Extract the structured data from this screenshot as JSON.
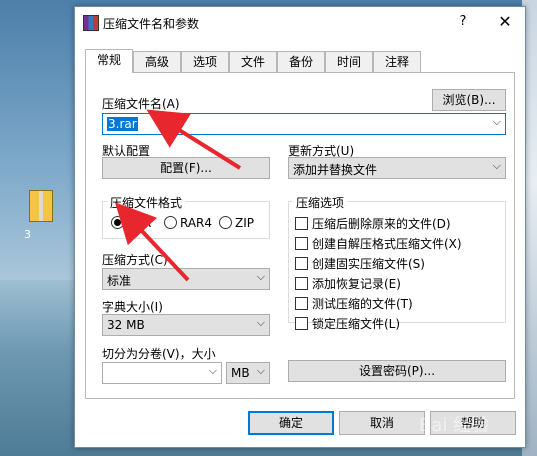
{
  "desktop": {
    "icon_label": "3"
  },
  "dialog": {
    "title": "压缩文件名和参数",
    "help": "?",
    "close": "✕"
  },
  "tabs": [
    {
      "label": "常规"
    },
    {
      "label": "高级"
    },
    {
      "label": "选项"
    },
    {
      "label": "文件"
    },
    {
      "label": "备份"
    },
    {
      "label": "时间"
    },
    {
      "label": "注释"
    }
  ],
  "general": {
    "archive_name_label": "压缩文件名(A)",
    "browse_label": "浏览(B)...",
    "archive_name_value": "3.rar",
    "default_profile_label": "默认配置",
    "profile_button": "配置(F)...",
    "update_mode_label": "更新方式(U)",
    "update_mode_value": "添加并替换文件",
    "format_group_title": "压缩文件格式",
    "formats": [
      {
        "label": "RAR",
        "selected": true
      },
      {
        "label": "RAR4",
        "selected": false
      },
      {
        "label": "ZIP",
        "selected": false
      }
    ],
    "options_group_title": "压缩选项",
    "options": [
      {
        "label": "压缩后删除原来的文件(D)",
        "checked": false
      },
      {
        "label": "创建自解压格式压缩文件(X)",
        "checked": false
      },
      {
        "label": "创建固实压缩文件(S)",
        "checked": false
      },
      {
        "label": "添加恢复记录(E)",
        "checked": false
      },
      {
        "label": "测试压缩的文件(T)",
        "checked": false
      },
      {
        "label": "锁定压缩文件(L)",
        "checked": false
      }
    ],
    "method_label": "压缩方式(C)",
    "method_value": "标准",
    "dict_label": "字典大小(I)",
    "dict_value": "32 MB",
    "split_label": "切分为分卷(V)，大小",
    "split_value": "",
    "split_unit": "MB",
    "password_button": "设置密码(P)..."
  },
  "footer": {
    "ok": "确定",
    "cancel": "取消",
    "help": "帮助"
  },
  "watermark": "Bai 经验"
}
